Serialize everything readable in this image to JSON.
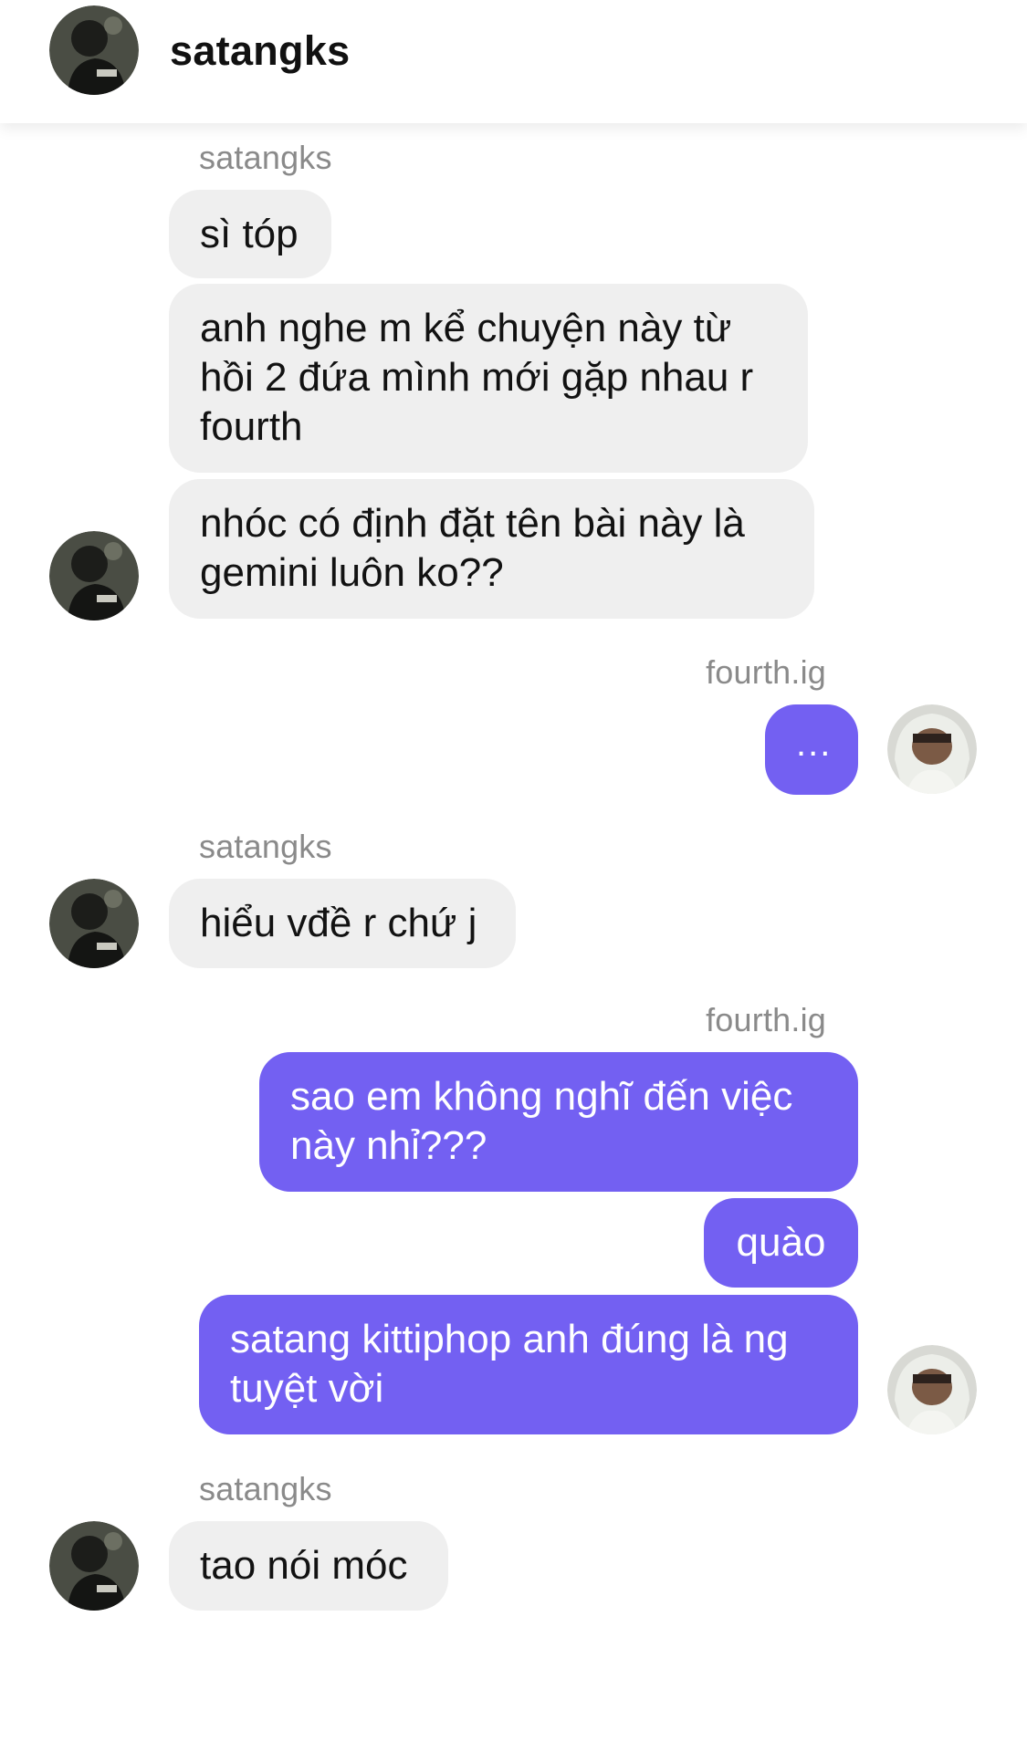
{
  "header": {
    "title": "satangks",
    "avatar_icon": "user-avatar-satangks"
  },
  "colors": {
    "incoming_bubble": "#efefef",
    "outgoing_bubble": "#7360f2",
    "sender_name": "#8a8a8a"
  },
  "messages": [
    {
      "group": 1,
      "sender": "satangks",
      "side": "left",
      "bubbles": [
        "sì tóp",
        "anh nghe m kể chuyện này từ hồi 2 đứa mình mới gặp nhau r fourth",
        "nhóc có định đặt tên bài này là gemini luôn ko??"
      ]
    },
    {
      "group": 2,
      "sender": "fourth.ig",
      "side": "right",
      "bubbles": [
        "..."
      ]
    },
    {
      "group": 3,
      "sender": "satangks",
      "side": "left",
      "bubbles": [
        "hiểu vđề r chứ j"
      ]
    },
    {
      "group": 4,
      "sender": "fourth.ig",
      "side": "right",
      "bubbles": [
        "sao em không nghĩ đến việc này nhỉ???",
        "quào",
        "satang kittiphop anh đúng là ng tuyệt vời"
      ]
    },
    {
      "group": 5,
      "sender": "satangks",
      "side": "left",
      "bubbles": [
        "tao nói móc"
      ]
    }
  ]
}
